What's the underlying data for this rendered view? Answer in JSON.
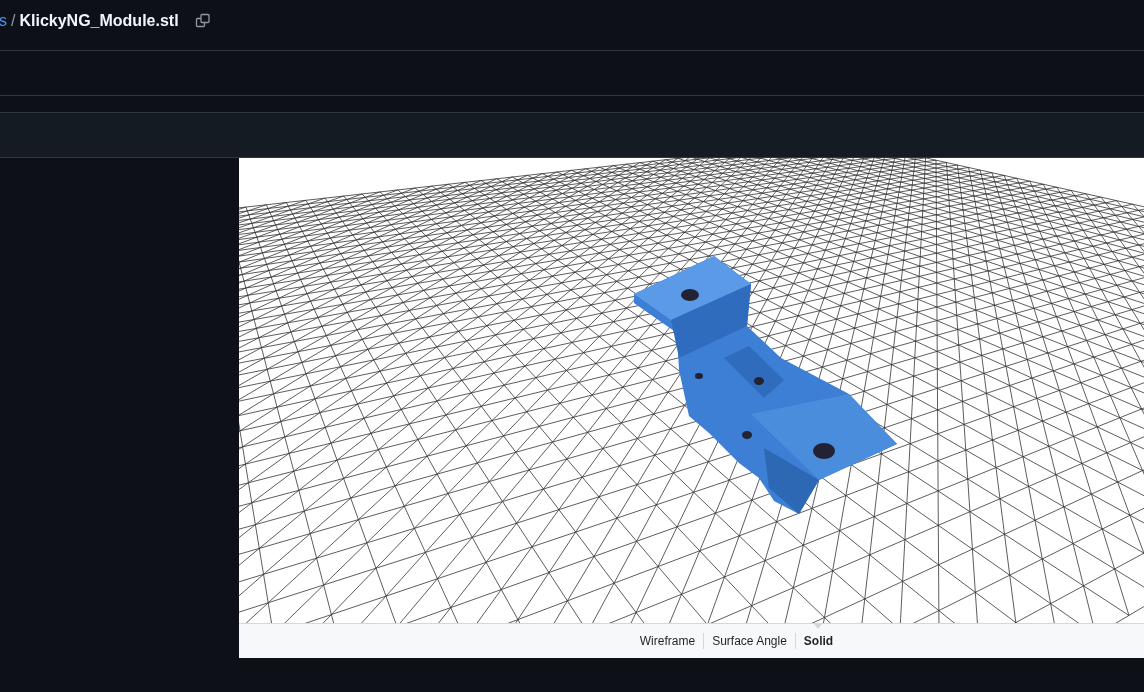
{
  "breadcrumb": {
    "parent": "s",
    "separator": "/",
    "file": "KlickyNG_Module.stl"
  },
  "viewer": {
    "modes": [
      {
        "label": "Wireframe",
        "selected": false
      },
      {
        "label": "Surface Angle",
        "selected": false
      },
      {
        "label": "Solid",
        "selected": true
      }
    ]
  }
}
